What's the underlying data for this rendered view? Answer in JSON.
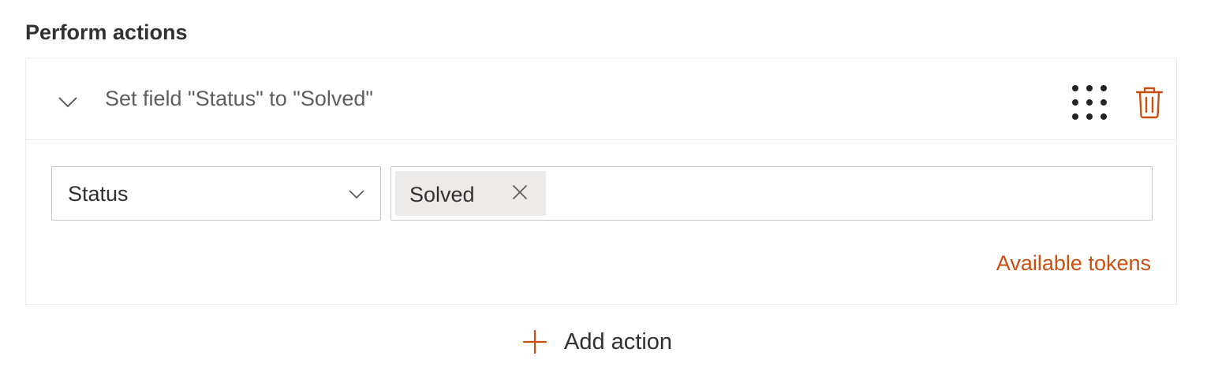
{
  "section": {
    "title": "Perform actions"
  },
  "action": {
    "summary": "Set field \"Status\" to \"Solved\"",
    "field": {
      "selected": "Status"
    },
    "value": {
      "tags": [
        "Solved"
      ]
    },
    "tokens_link": "Available tokens"
  },
  "add_action": {
    "label": "Add action"
  },
  "icons": {
    "collapse": "chevron-down-icon",
    "drag": "drag-handle-icon",
    "delete": "trash-icon",
    "dropdown": "chevron-down-icon",
    "remove_tag": "close-icon",
    "add": "plus-icon"
  },
  "colors": {
    "accent": "#ca5010",
    "text": "#323130",
    "muted_text": "#605e5c",
    "border": "#c8c6c4",
    "tag_bg": "#edebe9"
  }
}
